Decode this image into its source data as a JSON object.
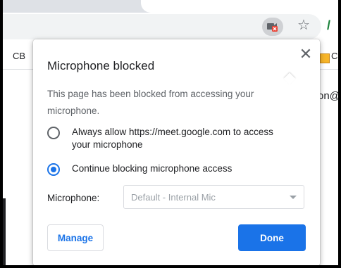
{
  "browser": {
    "bookmark_left_text": "CB",
    "bookmark_right_text": "C",
    "page_right_text": "on@",
    "icons": [
      "camera-blocked-icon",
      "star-icon",
      "extension-icon",
      "bookmark-folder-icon"
    ]
  },
  "popup": {
    "title": "Microphone blocked",
    "close_glyph": "✕",
    "description": "This page has been blocked from accessing your microphone.",
    "options": [
      {
        "label": "Always allow https://meet.google.com to access your microphone",
        "selected": false
      },
      {
        "label": "Continue blocking microphone access",
        "selected": true
      }
    ],
    "microphone_label": "Microphone:",
    "microphone_select_value": "Default - Internal Mic",
    "manage_button": "Manage",
    "done_button": "Done"
  },
  "colors": {
    "accent": "#1a73e8",
    "blocked_badge": "#ea4335",
    "text_primary": "#202124",
    "text_secondary": "#5f6368"
  }
}
